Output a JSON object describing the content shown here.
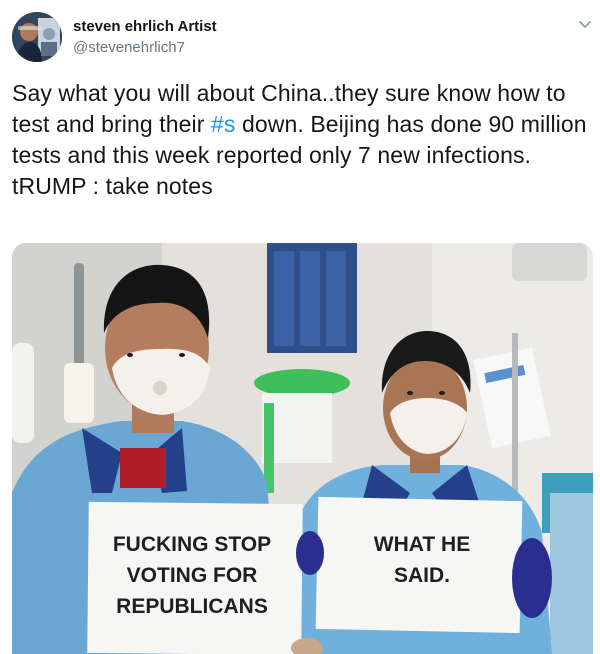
{
  "tweet": {
    "author": {
      "display_name": "steven ehrlich Artist",
      "handle": "@stevenehrlich7"
    },
    "text_lines": {
      "line1_before_hashtag": "Say what you will about China..they sure know how to test and bring their ",
      "hashtag": "#s",
      "line1_after_hashtag": " down. Beijing has done 90 million tests and this week reported only 7 new infections.",
      "line2": "tRUMP : take notes"
    },
    "media": {
      "sign_left": [
        "FUCKING STOP",
        "VOTING FOR",
        "REPUBLICANS"
      ],
      "sign_right": [
        "WHAT HE",
        "SAID."
      ]
    }
  },
  "colors": {
    "text": "#14171a",
    "secondary": "#657786",
    "hashtag": "#1b95e0",
    "scrub_blue": "#6aa7d3",
    "scrub_dark": "#24408a",
    "glove": "#2a2f8f"
  },
  "icons": {
    "caret": "chevron-down-icon"
  }
}
